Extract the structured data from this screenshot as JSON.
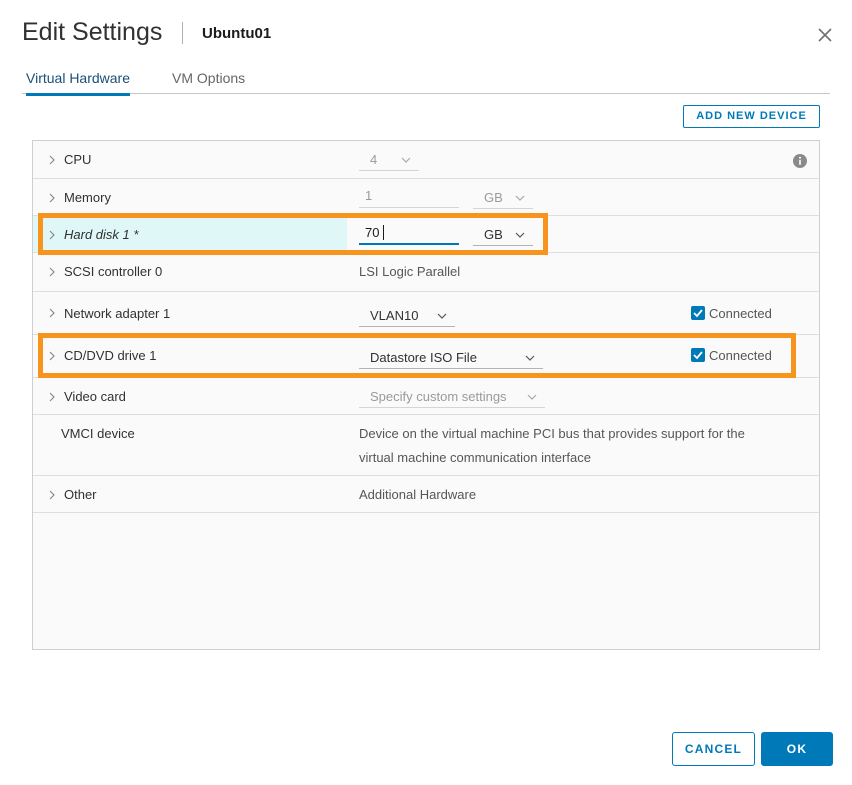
{
  "dialog": {
    "title": "Edit Settings",
    "vm_name": "Ubuntu01",
    "close_icon": "close-icon"
  },
  "tabs": [
    {
      "label": "Virtual Hardware",
      "active": true
    },
    {
      "label": "VM Options",
      "active": false
    }
  ],
  "toolbar": {
    "add_device_label": "ADD NEW DEVICE"
  },
  "hardware": {
    "cpu": {
      "label": "CPU",
      "value": "4"
    },
    "memory": {
      "label": "Memory",
      "value": "1",
      "unit": "GB"
    },
    "hard_disk": {
      "label": "Hard disk 1 *",
      "value": "70",
      "unit": "GB"
    },
    "scsi": {
      "label": "SCSI controller 0",
      "value": "LSI Logic Parallel"
    },
    "network": {
      "label": "Network adapter 1",
      "value": "VLAN10",
      "connected_label": "Connected",
      "connected": true
    },
    "cdrom": {
      "label": "CD/DVD drive 1",
      "value": "Datastore ISO File",
      "connected_label": "Connected",
      "connected": true
    },
    "video": {
      "label": "Video card",
      "value": "Specify custom settings"
    },
    "vmci": {
      "label": "VMCI device",
      "value_line1": "Device on the virtual machine PCI bus that provides support for the",
      "value_line2": "virtual machine communication interface"
    },
    "other": {
      "label": "Other",
      "value": "Additional Hardware"
    }
  },
  "footer": {
    "cancel_label": "CANCEL",
    "ok_label": "OK"
  },
  "colors": {
    "accent": "#0079b8",
    "highlight": "#f7941d",
    "edited_row": "#e0f7f7"
  }
}
